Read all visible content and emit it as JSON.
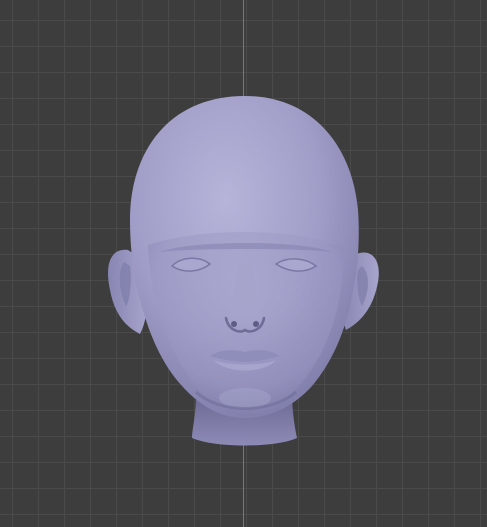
{
  "viewport": {
    "background_color": "#3d3d3d",
    "grid_color": "#4a4a4a",
    "z_axis_color": "#5b7bc0"
  },
  "model": {
    "material_color": "#9d9bc4",
    "shadow_color": "#6f6d98"
  }
}
